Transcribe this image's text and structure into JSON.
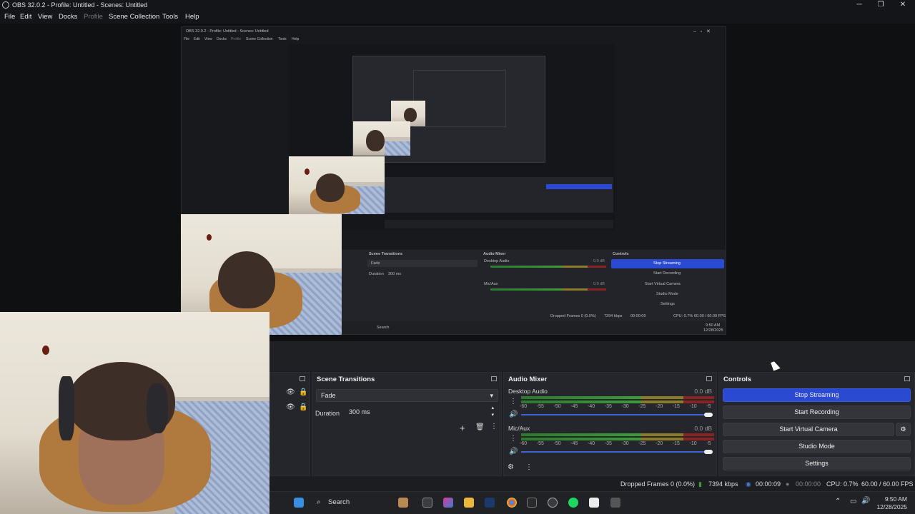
{
  "window": {
    "title": "OBS 32.0.2 - Profile: Untitled - Scenes: Untitled",
    "min": "─",
    "max": "❐",
    "close": "✕"
  },
  "menu": [
    "File",
    "Edit",
    "View",
    "Docks",
    "Profile",
    "Scene Collection",
    "Tools",
    "Help"
  ],
  "nested": {
    "title": "OBS 32.0.2 - Profile: Untitled - Scenes: Untitled",
    "menu": [
      "File",
      "Edit",
      "View",
      "Docks",
      "Profile",
      "Scene Collection",
      "Tools",
      "Help"
    ],
    "transitions_title": "Scene Transitions",
    "transition": "Fade",
    "duration_label": "Duration",
    "duration": "300 ms",
    "mixer_title": "Audio Mixer",
    "desktop_audio": "Desktop Audio",
    "mic": "Mic/Aux",
    "db": "0.0 dB",
    "controls_title": "Controls",
    "stop_streaming": "Stop Streaming",
    "start_recording": "Start Recording",
    "start_virtual_camera": "Start Virtual Camera",
    "studio_mode": "Studio Mode",
    "settings": "Settings",
    "status": "Dropped Frames 0 (0.0%)",
    "kbps": "7394 kbps",
    "rec": "00:00:09",
    "cpu": "CPU: 0.7%",
    "fps": "60.00 / 60.00 FPS",
    "search": "Search",
    "time": "9:50 AM",
    "date": "12/28/2025"
  },
  "transitions": {
    "title": "Scene Transitions",
    "selected": "Fade",
    "duration_label": "Duration",
    "duration_value": "300 ms"
  },
  "mixer": {
    "title": "Audio Mixer",
    "channels": [
      {
        "name": "Desktop Audio",
        "db": "0.0 dB",
        "volume": 1.0
      },
      {
        "name": "Mic/Aux",
        "db": "0.0 dB",
        "volume": 1.0
      }
    ],
    "ticks": [
      "-60",
      "-55",
      "-50",
      "-45",
      "-40",
      "-35",
      "-30",
      "-25",
      "-20",
      "-15",
      "-10",
      "-5",
      "0"
    ]
  },
  "controls": {
    "title": "Controls",
    "stop_streaming": "Stop Streaming",
    "start_recording": "Start Recording",
    "start_virtual_camera": "Start Virtual Camera",
    "studio_mode": "Studio Mode",
    "settings": "Settings"
  },
  "status": {
    "dropped": "Dropped Frames 0 (0.0%)",
    "bitrate": "7394 kbps",
    "stream_time": "00:00:09",
    "rec_time": "00:00:00",
    "cpu": "CPU: 0.7%",
    "fps": "60.00 / 60.00 FPS"
  },
  "taskbar": {
    "search": "Search",
    "time": "9:50 AM",
    "date": "12/28/2025"
  },
  "colors": {
    "accent": "#2a4bd1",
    "bg": "#1c1d21",
    "dock": "#25262b"
  }
}
